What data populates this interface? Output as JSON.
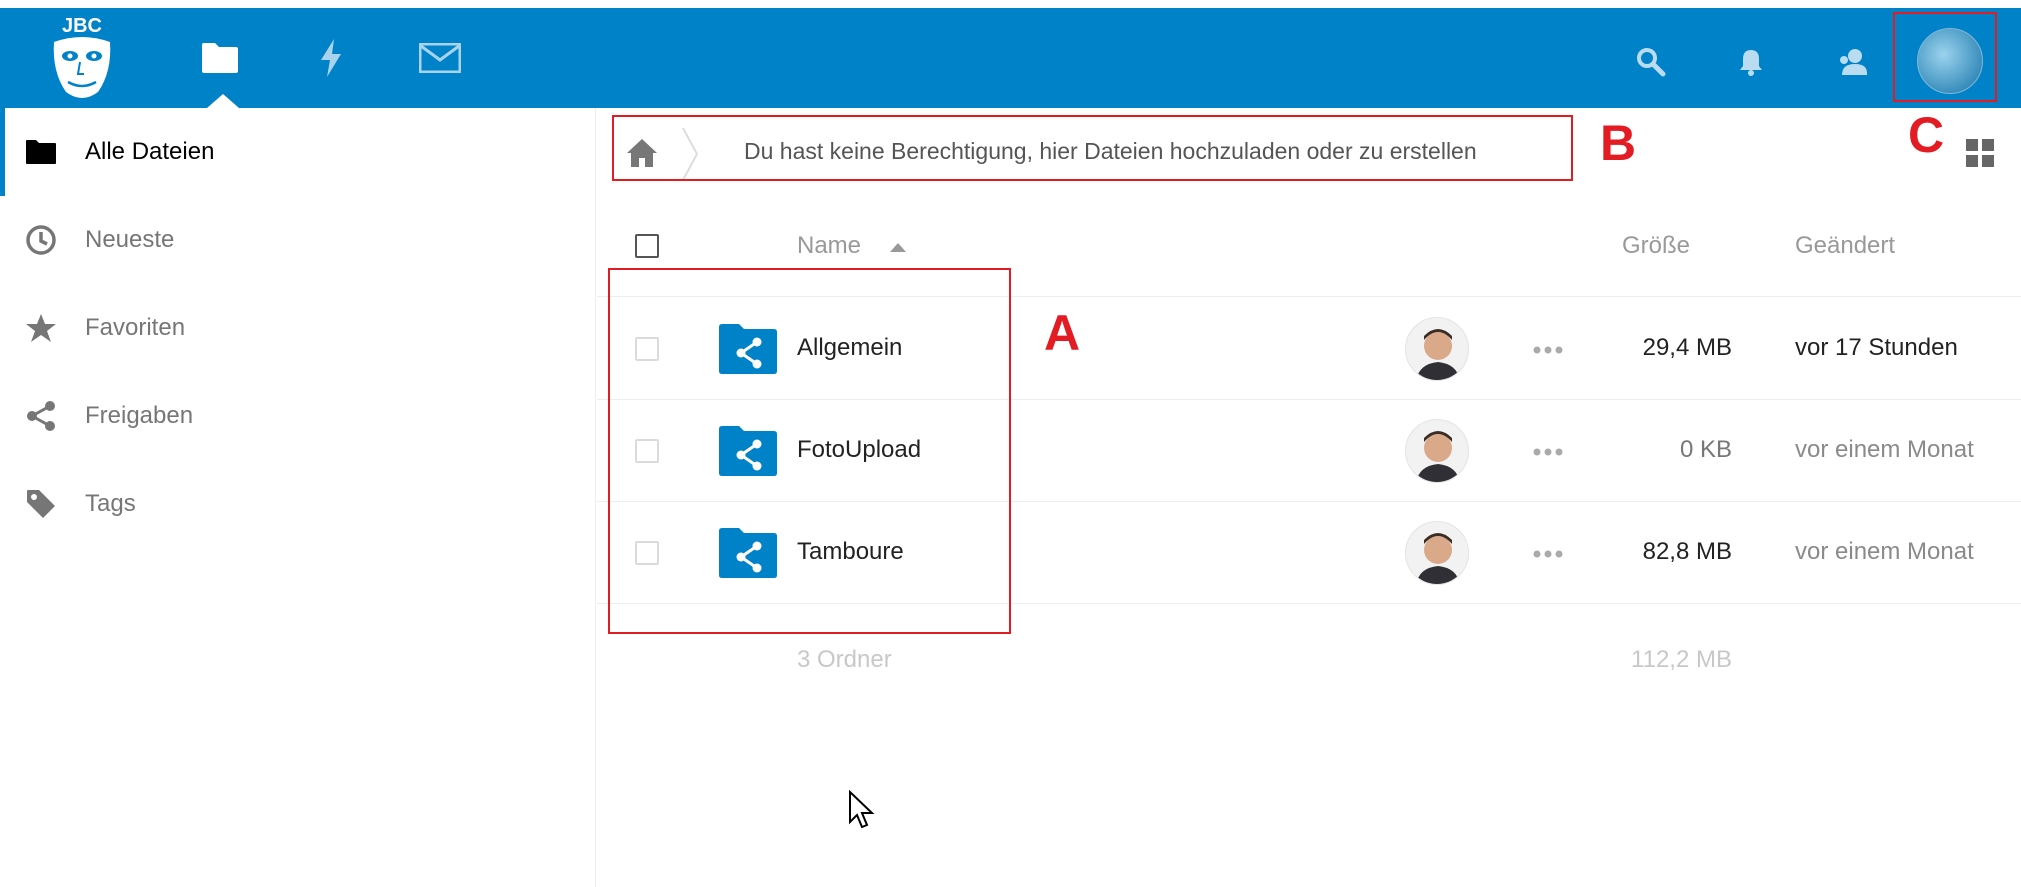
{
  "header": {
    "logo_text": "JBC",
    "apps": [
      {
        "name": "files",
        "icon": "folder-icon"
      },
      {
        "name": "activity",
        "icon": "lightning-icon"
      },
      {
        "name": "mail",
        "icon": "mail-icon"
      }
    ],
    "right_icons": [
      "search-icon",
      "bell-icon",
      "contacts-icon",
      "user-avatar"
    ]
  },
  "sidebar": {
    "items": [
      {
        "label": "Alle Dateien",
        "icon": "folder-icon",
        "active": true
      },
      {
        "label": "Neueste",
        "icon": "clock-icon"
      },
      {
        "label": "Favoriten",
        "icon": "star-icon"
      },
      {
        "label": "Freigaben",
        "icon": "share-icon"
      },
      {
        "label": "Tags",
        "icon": "tag-icon"
      }
    ]
  },
  "breadcrumb": {
    "home_icon": "home-icon",
    "message": "Du hast keine Berechtigung, hier Dateien hochzuladen oder zu erstellen"
  },
  "list": {
    "columns": {
      "name": "Name",
      "size": "Größe",
      "modified": "Geändert"
    },
    "rows": [
      {
        "name": "Allgemein",
        "size": "29,4 MB",
        "modified": "vor 17 Stunden"
      },
      {
        "name": "FotoUpload",
        "size": "0 KB",
        "modified": "vor einem Monat"
      },
      {
        "name": "Tamboure",
        "size": "82,8 MB",
        "modified": "vor einem Monat"
      }
    ],
    "summary": {
      "count": "3 Ordner",
      "total": "112,2 MB"
    }
  },
  "annotations": {
    "a": "A",
    "b": "B",
    "c": "C"
  },
  "colors": {
    "brand": "#0082c9",
    "marker": "#e31b23"
  }
}
